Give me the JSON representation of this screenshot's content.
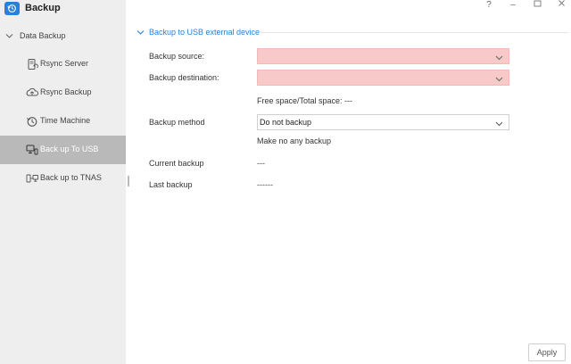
{
  "app": {
    "title": "Backup"
  },
  "window_controls": {
    "help": "?",
    "minimize": "–",
    "maximize": "☐",
    "close": "✕"
  },
  "sidebar": {
    "section": "Data Backup",
    "items": [
      {
        "label": "Rsync Server",
        "icon": "rsync-server-icon",
        "active": false
      },
      {
        "label": "Rsync Backup",
        "icon": "rsync-backup-icon",
        "active": false
      },
      {
        "label": "Time Machine",
        "icon": "time-machine-icon",
        "active": false
      },
      {
        "label": "Back up To USB",
        "icon": "usb-backup-icon",
        "active": true
      },
      {
        "label": "Back up to TNAS",
        "icon": "tnas-backup-icon",
        "active": false
      }
    ]
  },
  "main": {
    "group_title": "Backup to USB external device",
    "backup_source": {
      "label": "Backup source:",
      "value": ""
    },
    "backup_destination": {
      "label": "Backup destination:",
      "value": ""
    },
    "free_space": "Free space/Total space: ---",
    "backup_method": {
      "label": "Backup method",
      "value": "Do not backup",
      "description": "Make no any backup"
    },
    "current_backup": {
      "label": "Current backup",
      "value": "---"
    },
    "last_backup": {
      "label": "Last backup",
      "value": "------"
    },
    "apply_label": "Apply"
  },
  "colors": {
    "accent": "#2b7fd8",
    "error_fill": "#f7c9c9",
    "active_nav": "#b9b9b9",
    "sidebar_bg": "#eeeeee"
  }
}
